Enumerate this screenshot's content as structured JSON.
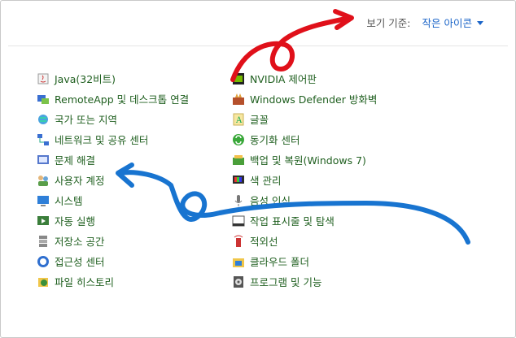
{
  "view": {
    "label": "보기 기준:",
    "selected": "작은 아이콘"
  },
  "left_items": [
    {
      "label": "Java(32비트)",
      "icon": "java-icon"
    },
    {
      "label": "RemoteApp 및 데스크톱 연결",
      "icon": "remote-desktop-icon"
    },
    {
      "label": "국가 또는 지역",
      "icon": "globe-clock-icon"
    },
    {
      "label": "네트워크 및 공유 센터",
      "icon": "network-icon"
    },
    {
      "label": "문제 해결",
      "icon": "troubleshoot-icon"
    },
    {
      "label": "사용자 계정",
      "icon": "user-accounts-icon"
    },
    {
      "label": "시스템",
      "icon": "system-monitor-icon"
    },
    {
      "label": "자동 실행",
      "icon": "autoplay-icon"
    },
    {
      "label": "저장소 공간",
      "icon": "storage-icon"
    },
    {
      "label": "접근성 센터",
      "icon": "accessibility-icon"
    },
    {
      "label": "파일 히스토리",
      "icon": "file-history-icon"
    }
  ],
  "right_items": [
    {
      "label": "NVIDIA 제어판",
      "icon": "nvidia-icon"
    },
    {
      "label": "Windows Defender 방화벽",
      "icon": "firewall-icon"
    },
    {
      "label": "글꼴",
      "icon": "font-icon"
    },
    {
      "label": "동기화 센터",
      "icon": "sync-icon"
    },
    {
      "label": "백업 및 복원(Windows 7)",
      "icon": "backup-icon"
    },
    {
      "label": "색 관리",
      "icon": "color-management-icon"
    },
    {
      "label": "음성 인식",
      "icon": "microphone-icon"
    },
    {
      "label": "작업 표시줄 및 탐색",
      "icon": "taskbar-icon"
    },
    {
      "label": "적외선",
      "icon": "infrared-icon"
    },
    {
      "label": "클라우드 폴더",
      "icon": "cloud-folder-icon"
    },
    {
      "label": "프로그램 및 기능",
      "icon": "programs-icon"
    }
  ],
  "colors": {
    "red_annotation": "#e0101a",
    "blue_annotation": "#1874d0"
  }
}
